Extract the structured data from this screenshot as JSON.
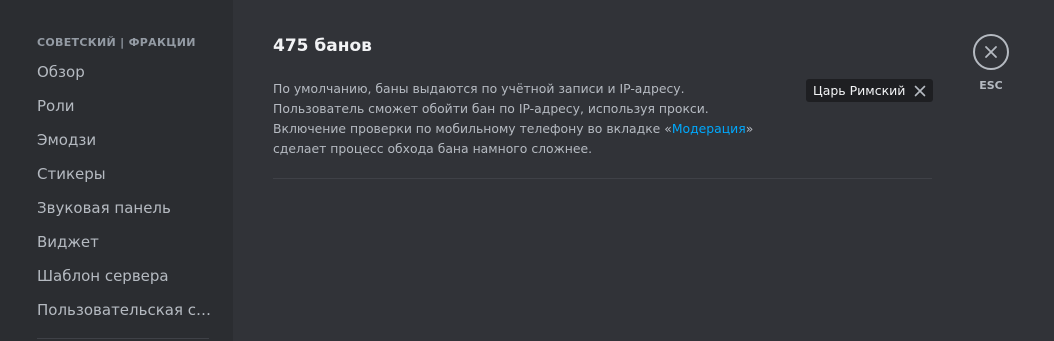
{
  "sidebar": {
    "header": "СОВЕТСКИЙ | ФРАКЦИИ",
    "items": [
      {
        "label": "Обзор"
      },
      {
        "label": "Роли"
      },
      {
        "label": "Эмодзи"
      },
      {
        "label": "Стикеры"
      },
      {
        "label": "Звуковая панель"
      },
      {
        "label": "Виджет"
      },
      {
        "label": "Шаблон сервера"
      },
      {
        "label": "Пользовательская сс..."
      }
    ]
  },
  "main": {
    "title": "475 банов",
    "description_before": "По умолчанию, баны выдаются по учётной записи и IP-адресу. Пользователь сможет обойти бан по IP-адресу, используя прокси. Включение проверки по мобильному телефону во вкладке «",
    "description_link": "Модерация",
    "description_after": "» сделает процесс обхода бана намного сложнее.",
    "ban_tag": {
      "label": "Царь Римский",
      "remove_icon": "close-icon"
    }
  },
  "close": {
    "icon": "close-icon",
    "label": "ESC"
  },
  "colors": {
    "background": "#313338",
    "sidebar": "#2b2d31",
    "link": "#00a8fc",
    "tag_background": "#1e1f22"
  }
}
